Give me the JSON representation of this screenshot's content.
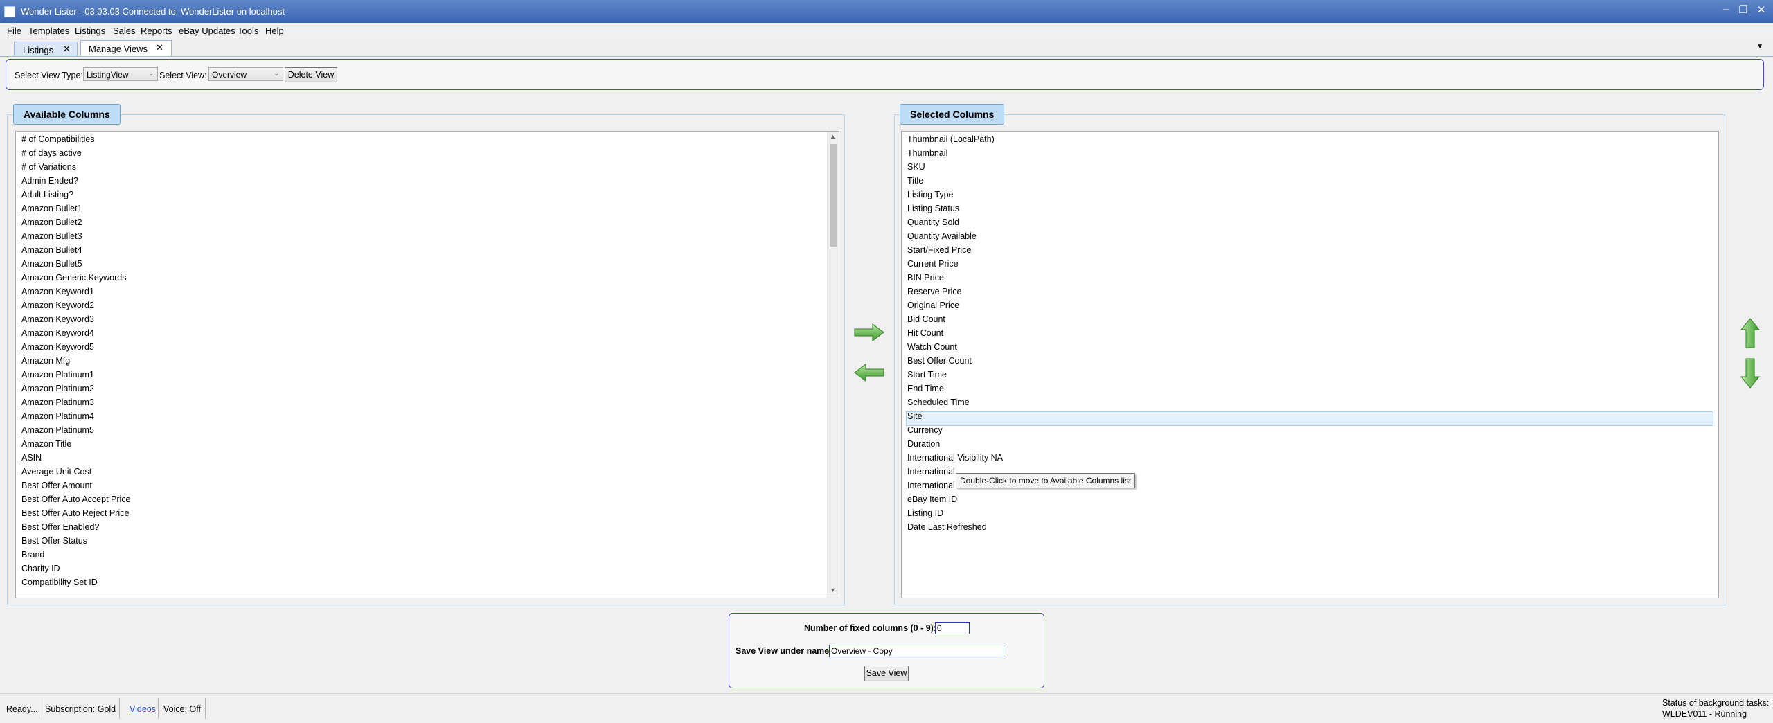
{
  "window": {
    "title": "Wonder Lister - 03.03.03 Connected to: WonderLister on localhost",
    "minimize_glyph": "–",
    "restore_glyph": "❐",
    "close_glyph": "✕"
  },
  "menu": [
    "File",
    "Templates",
    "Listings",
    "Sales",
    "Reports",
    "eBay Updates",
    "Tools",
    "Help"
  ],
  "tabs": [
    {
      "label": "Listings",
      "close": "✕"
    },
    {
      "label": "Manage Views",
      "close": "✕"
    }
  ],
  "tab_overflow_glyph": "▼",
  "toolbar": {
    "view_type_label": "Select View Type:",
    "view_type_value": "ListingView",
    "view_label": "Select View:",
    "view_value": "Overview",
    "dropdown_glyph": "⌄",
    "delete_label": "Delete View"
  },
  "available": {
    "title": "Available Columns",
    "items": [
      "# of Compatibilities",
      "# of days active",
      "# of Variations",
      "Admin Ended?",
      "Adult Listing?",
      "Amazon Bullet1",
      "Amazon Bullet2",
      "Amazon Bullet3",
      "Amazon Bullet4",
      "Amazon Bullet5",
      "Amazon Generic Keywords",
      "Amazon Keyword1",
      "Amazon Keyword2",
      "Amazon Keyword3",
      "Amazon Keyword4",
      "Amazon Keyword5",
      "Amazon Mfg",
      "Amazon Platinum1",
      "Amazon Platinum2",
      "Amazon Platinum3",
      "Amazon Platinum4",
      "Amazon Platinum5",
      "Amazon Title",
      "ASIN",
      "Average Unit Cost",
      "Best Offer Amount",
      "Best Offer Auto Accept Price",
      "Best Offer Auto Reject Price",
      "Best Offer Enabled?",
      "Best Offer Status",
      "Brand",
      "Charity ID",
      "Compatibility Set ID"
    ],
    "scroll_up": "▲",
    "scroll_down": "▼"
  },
  "selected": {
    "title": "Selected Columns",
    "items": [
      "Thumbnail (LocalPath)",
      "Thumbnail",
      "SKU",
      "Title",
      "Listing Type",
      "Listing Status",
      "Quantity Sold",
      "Quantity Available",
      "Start/Fixed Price",
      "Current Price",
      "BIN Price",
      "Reserve Price",
      "Original Price",
      "Bid Count",
      "Hit Count",
      "Watch Count",
      "Best Offer Count",
      "Start Time",
      "End Time",
      "Scheduled Time",
      "Site",
      "Currency",
      "Duration",
      "International Visibility NA",
      "International",
      "International",
      "eBay Item ID",
      "Listing ID",
      "Date Last Refreshed"
    ],
    "selected_item": "Site",
    "tooltip": "Double-Click to move to Available Columns list"
  },
  "save": {
    "fixed_label": "Number of fixed columns (0 - 9):",
    "fixed_value": "0",
    "name_label": "Save View under name:",
    "name_value": "Overview - Copy",
    "save_label": "Save View"
  },
  "status": {
    "ready": "Ready...",
    "subscription": "Subscription: Gold",
    "videos": "Videos",
    "voice": "Voice:  Off",
    "bg_title": "Status of background tasks:",
    "bg_task": "WLDEV011 - Running"
  },
  "colors": {
    "titlebar": "#3b66b3",
    "panel_border": "#3f4ec7",
    "group_title_bg": "#bfdcf7",
    "arrow_green": "#4caf50",
    "selection": "#e5f2fd"
  }
}
